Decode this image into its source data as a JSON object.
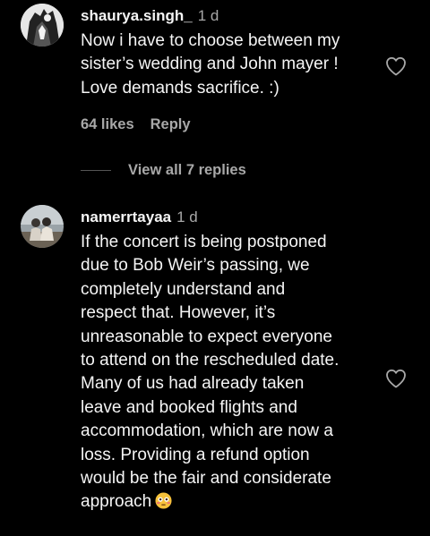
{
  "comments": [
    {
      "username": "shaurya.singh_",
      "time": "1 d",
      "lines": [
        "Now i have to choose between my",
        "sister’s wedding and John mayer !",
        "Love demands sacrifice. :)"
      ],
      "likes": "64 likes",
      "reply": "Reply",
      "view_replies": "View all 7 replies",
      "avatar_icon": "profile-photo"
    },
    {
      "username": "namerrtayaa",
      "time": "1 d",
      "lines": [
        "If the concert is being postponed",
        "due to Bob Weir’s passing, we",
        "completely understand and",
        "respect that. However, it’s",
        "unreasonable to expect everyone",
        "to attend on the rescheduled date.",
        "Many of us had already taken",
        "leave and booked flights and",
        "accommodation, which are now a",
        "loss. Providing a refund option",
        "would be the fair and considerate",
        "approach"
      ],
      "emoji": "flushed-face-emoji",
      "avatar_icon": "profile-photo"
    }
  ],
  "icons": {
    "like": "heart-outline-icon"
  },
  "colors": {
    "background": "#000000",
    "primary_text": "#f5f5f5",
    "secondary_text": "#a8a8a8"
  }
}
